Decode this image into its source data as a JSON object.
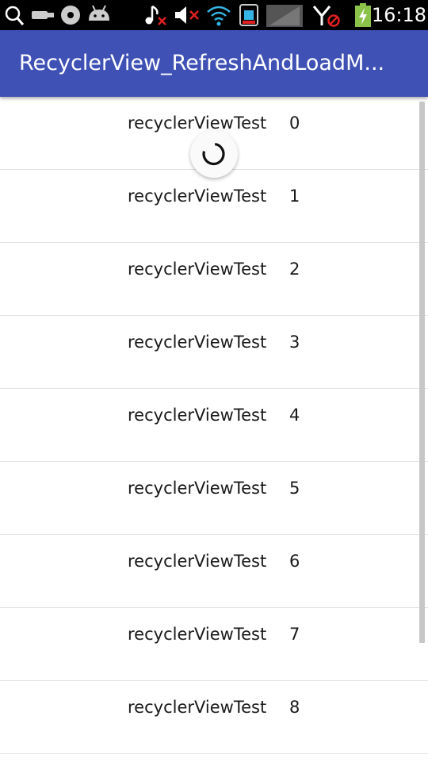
{
  "status_bar": {
    "time": "16:18",
    "icons": [
      "search-icon",
      "usb-icon",
      "sd-card-icon",
      "android-debug-icon",
      "music-muted-icon",
      "volume-muted-icon",
      "wifi-icon",
      "sim-card-icon",
      "signal-icon",
      "data-blocked-icon",
      "battery-charging-icon"
    ]
  },
  "app_bar": {
    "title": "RecyclerView_RefreshAndLoadM...",
    "color": "#3f51b5"
  },
  "refresh_indicator": {
    "icon": "spinner-icon",
    "visible": true
  },
  "list": {
    "items": [
      {
        "label": "recyclerViewTest",
        "index": "0"
      },
      {
        "label": "recyclerViewTest",
        "index": "1"
      },
      {
        "label": "recyclerViewTest",
        "index": "2"
      },
      {
        "label": "recyclerViewTest",
        "index": "3"
      },
      {
        "label": "recyclerViewTest",
        "index": "4"
      },
      {
        "label": "recyclerViewTest",
        "index": "5"
      },
      {
        "label": "recyclerViewTest",
        "index": "6"
      },
      {
        "label": "recyclerViewTest",
        "index": "7"
      },
      {
        "label": "recyclerViewTest",
        "index": "8"
      }
    ]
  }
}
